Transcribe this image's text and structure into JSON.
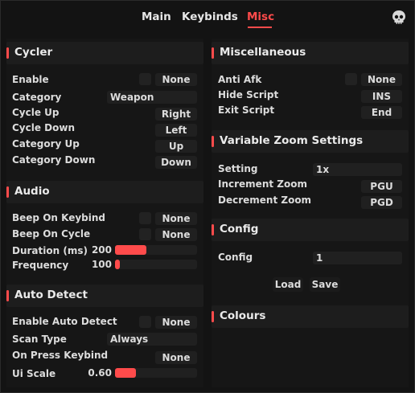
{
  "tabs": [
    "Main",
    "Keybinds",
    "Misc"
  ],
  "active_tab": "Misc",
  "accent_color": "#ff4b4b",
  "cycler": {
    "title": "Cycler",
    "enable": {
      "label": "Enable",
      "keybind": "None"
    },
    "category": {
      "label": "Category",
      "value": "Weapon"
    },
    "cycle_up": {
      "label": "Cycle Up",
      "value": "Right"
    },
    "cycle_down": {
      "label": "Cycle Down",
      "value": "Left"
    },
    "category_up": {
      "label": "Category Up",
      "value": "Up"
    },
    "category_down": {
      "label": "Category Down",
      "value": "Down"
    }
  },
  "audio": {
    "title": "Audio",
    "beep_on_keybind": {
      "label": "Beep On Keybind",
      "keybind": "None"
    },
    "beep_on_cycle": {
      "label": "Beep On Cycle",
      "keybind": "None"
    },
    "duration": {
      "label": "Duration (ms)",
      "value": "200",
      "fraction": 0.38
    },
    "frequency": {
      "label": "Frequency",
      "value": "100",
      "fraction": 0.06
    }
  },
  "auto_detect": {
    "title": "Auto Detect",
    "enable_auto_detect": {
      "label": "Enable Auto Detect",
      "keybind": "None"
    },
    "scan_type": {
      "label": "Scan Type",
      "value": "Always"
    },
    "on_press_keybind": {
      "label": "On Press Keybind",
      "value": "None"
    },
    "ui_scale": {
      "label": "Ui Scale",
      "value": "0.60",
      "fraction": 0.25
    }
  },
  "miscellaneous": {
    "title": "Miscellaneous",
    "anti_afk": {
      "label": "Anti Afk",
      "keybind": "None"
    },
    "hide_script": {
      "label": "Hide Script",
      "value": "INS"
    },
    "exit_script": {
      "label": "Exit Script",
      "value": "End"
    }
  },
  "variable_zoom": {
    "title": "Variable Zoom Settings",
    "setting": {
      "label": "Setting",
      "value": "1x"
    },
    "increment_zoom": {
      "label": "Increment Zoom",
      "value": "PGU"
    },
    "decrement_zoom": {
      "label": "Decrement Zoom",
      "value": "PGD"
    }
  },
  "config": {
    "title": "Config",
    "config_field": {
      "label": "Config",
      "value": "1"
    },
    "load_label": "Load",
    "save_label": "Save"
  },
  "colours": {
    "title": "Colours"
  }
}
